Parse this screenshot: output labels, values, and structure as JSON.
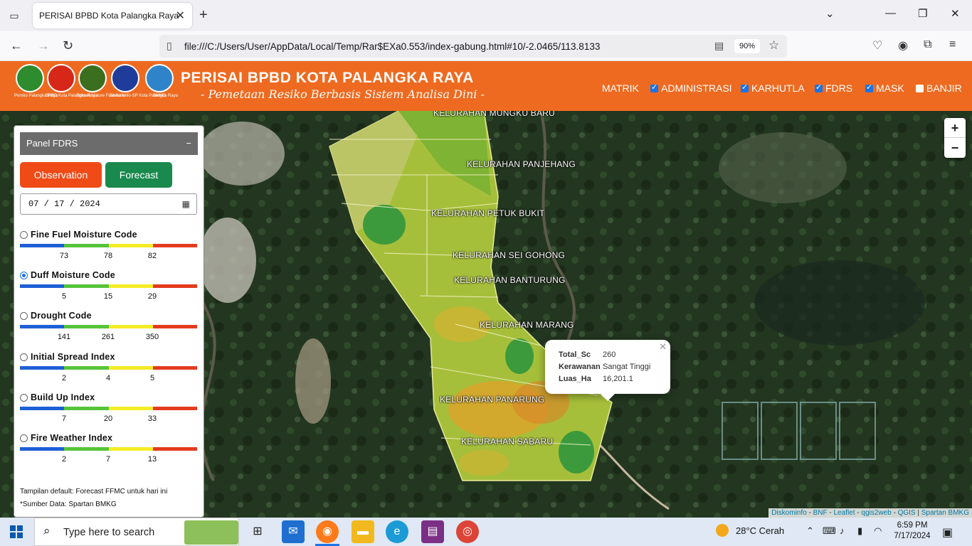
{
  "browser": {
    "tab_title": "PERISAI BPBD Kota Palangka Raya",
    "url": "file:///C:/Users/User/AppData/Local/Temp/Rar$EXa0.553/index-gabung.html#10/-2.0465/113.8133",
    "zoom": "90%"
  },
  "header": {
    "title": "PERISAI BPBD KOTA PALANGKA RAYA",
    "subtitle": "- Pemetaan Resiko Berbasis Sistem Analisa Dini -",
    "logos": [
      {
        "caption": "Pemko Palangka Raya",
        "color": "#2e8b2e"
      },
      {
        "caption": "BPBD Kota Palangka Raya",
        "color": "#d62718"
      },
      {
        "caption": "Borneo Nature Foundation",
        "color": "#3c6e1f"
      },
      {
        "caption": "Diskominfo-SP Kota Palangka Raya",
        "color": "#1f3c9a"
      },
      {
        "caption": "BMKG",
        "color": "#2f84c9"
      }
    ],
    "menu": [
      {
        "label": "MATRIK",
        "checkbox": false
      },
      {
        "label": "ADMINISTRASI",
        "checkbox": true,
        "checked": true
      },
      {
        "label": "KARHUTLA",
        "checkbox": true,
        "checked": true
      },
      {
        "label": "FDRS",
        "checkbox": true,
        "checked": true
      },
      {
        "label": "MASK",
        "checkbox": true,
        "checked": true
      },
      {
        "label": "BANJIR",
        "checkbox": true,
        "checked": false
      }
    ]
  },
  "panel": {
    "title": "Panel FDRS",
    "collapse": "−",
    "observation_label": "Observation",
    "forecast_label": "Forecast",
    "date": "07 / 17 / 2024",
    "indices": [
      {
        "name": "Fine Fuel Moisture Code",
        "selected": false,
        "thresholds": [
          "73",
          "78",
          "82"
        ]
      },
      {
        "name": "Duff Moisture Code",
        "selected": true,
        "thresholds": [
          "5",
          "15",
          "29"
        ]
      },
      {
        "name": "Drought Code",
        "selected": false,
        "thresholds": [
          "141",
          "261",
          "350"
        ]
      },
      {
        "name": "Initial Spread Index",
        "selected": false,
        "thresholds": [
          "2",
          "4",
          "5"
        ]
      },
      {
        "name": "Build Up Index",
        "selected": false,
        "thresholds": [
          "7",
          "20",
          "33"
        ]
      },
      {
        "name": "Fire Weather Index",
        "selected": false,
        "thresholds": [
          "2",
          "7",
          "13"
        ]
      }
    ],
    "scale_colors": [
      "#1e5fd6",
      "#56c43a",
      "#f4ec25",
      "#e43b1f"
    ],
    "note_default": "Tampilan default: Forecast FFMC untuk hari ini",
    "note_source": "*Sumber Data: Spartan BMKG"
  },
  "map": {
    "kelurahan": [
      "KELURAHAN MUNGKU BARU",
      "KELURAHAN PANJEHANG",
      "KELURAHAN PETUK BUKIT",
      "KELURAHAN SEI GOHONG",
      "KELURAHAN BANTURUNG",
      "KELURAHAN MARANG",
      "KELURAHAN PANARUNG",
      "KELURAHAN SABARU"
    ],
    "popup": {
      "fields": [
        {
          "key": "Total_Sc",
          "value": "260"
        },
        {
          "key": "Kerawanan",
          "value": "Sangat Tinggi"
        },
        {
          "key": "Luas_Ha",
          "value": "16,201.1"
        }
      ]
    },
    "zoom_in": "+",
    "zoom_out": "−",
    "attribution": [
      "Diskominfo",
      "BNF",
      "Leaflet",
      "qgis2web",
      "QGIS",
      "Spartan BMKG"
    ]
  },
  "taskbar": {
    "search_placeholder": "Type here to search",
    "weather": "28°C  Cerah",
    "time": "6:59 PM",
    "date": "7/17/2024"
  }
}
